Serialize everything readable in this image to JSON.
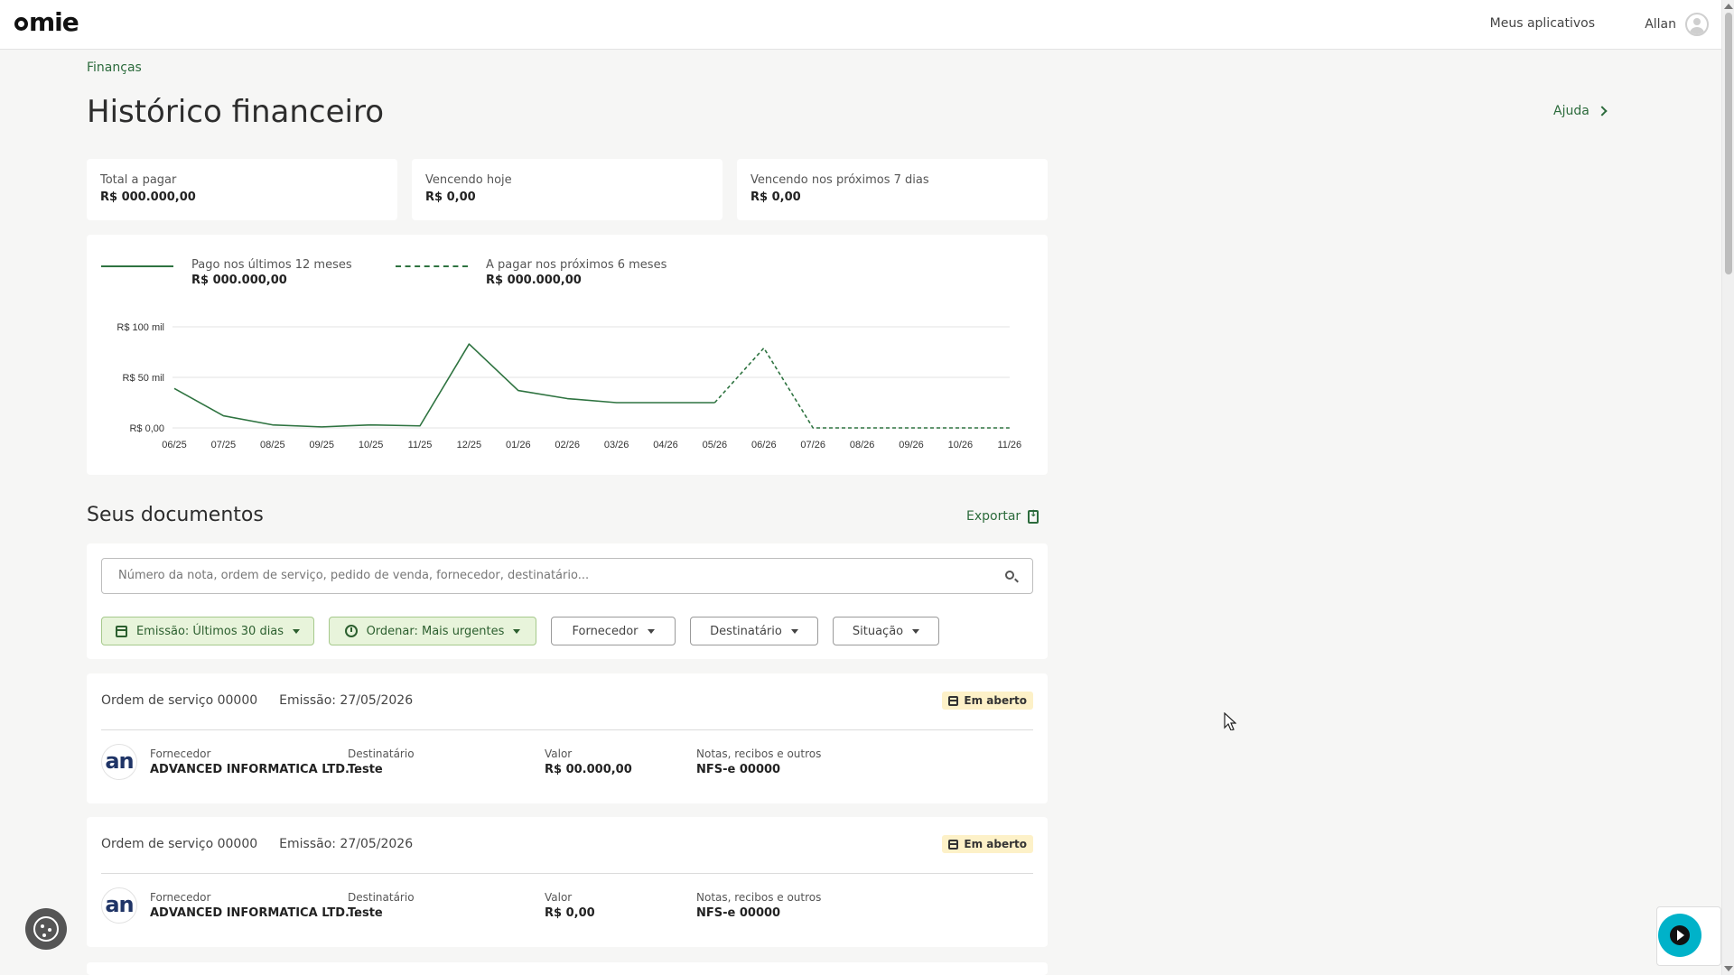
{
  "header": {
    "logo": "omie",
    "apps_link": "Meus aplicativos",
    "user_name": "Allan"
  },
  "breadcrumb": "Finanças",
  "page_title": "Histórico financeiro",
  "help_label": "Ajuda",
  "stats": [
    {
      "label": "Total a pagar",
      "value": "R$ 000.000,00"
    },
    {
      "label": "Vencendo hoje",
      "value": "R$ 0,00"
    },
    {
      "label": "Vencendo nos próximos 7 dias",
      "value": "R$ 0,00"
    }
  ],
  "legend": {
    "paid": {
      "label": "Pago nos últimos 12 meses",
      "value": "R$ 000.000,00"
    },
    "to_pay": {
      "label": "A pagar nos próximos 6 meses",
      "value": "R$ 000.000,00"
    }
  },
  "chart_data": {
    "type": "line",
    "categories": [
      "06/25",
      "07/25",
      "08/25",
      "09/25",
      "10/25",
      "11/25",
      "12/25",
      "01/26",
      "02/26",
      "03/26",
      "04/26",
      "05/26",
      "06/26",
      "07/26",
      "08/26",
      "09/26",
      "10/26",
      "11/26"
    ],
    "yticks": [
      "R$ 0,00",
      "R$ 50 mil",
      "R$ 100 mil"
    ],
    "ylim": [
      0,
      100
    ],
    "series": [
      {
        "name": "Pago nos últimos 12 meses",
        "style": "solid",
        "values": [
          39,
          12,
          3,
          1,
          3,
          2,
          83,
          37,
          29,
          25,
          25,
          25
        ]
      },
      {
        "name": "A pagar nos próximos 6 meses",
        "style": "dashed",
        "start_index": 11,
        "values": [
          25,
          79,
          0,
          0,
          0,
          0,
          0
        ]
      }
    ],
    "color": "#2e7340",
    "grid": true
  },
  "documents_title": "Seus documentos",
  "export_label": "Exportar",
  "search": {
    "placeholder": "Número da nota, ordem de serviço, pedido de venda, fornecedor, destinatário..."
  },
  "filters": {
    "emission": "Emissão: Últimos 30 dias",
    "order": "Ordenar: Mais urgentes",
    "supplier": "Fornecedor",
    "recipient": "Destinatário",
    "situation": "Situação"
  },
  "documents": [
    {
      "title": "Ordem de serviço 00000",
      "emission": "Emissão: 27/05/2026",
      "status": "Em aberto",
      "supplier_label": "Fornecedor",
      "supplier": "ADVANCED INFORMATICA LTD...",
      "recipient_label": "Destinatário",
      "recipient": "Teste",
      "value_label": "Valor",
      "value": "R$ 00.000,00",
      "notes_label": "Notas, recibos e outros",
      "notes": "NFS-e 00000",
      "logo_text": "an"
    },
    {
      "title": "Ordem de serviço 00000",
      "emission": "Emissão: 27/05/2026",
      "status": "Em aberto",
      "supplier_label": "Fornecedor",
      "supplier": "ADVANCED INFORMATICA LTD...",
      "recipient_label": "Destinatário",
      "recipient": "Teste",
      "value_label": "Valor",
      "value": "R$ 0,00",
      "notes_label": "Notas, recibos e outros",
      "notes": "NFS-e 00000",
      "logo_text": "an"
    }
  ]
}
